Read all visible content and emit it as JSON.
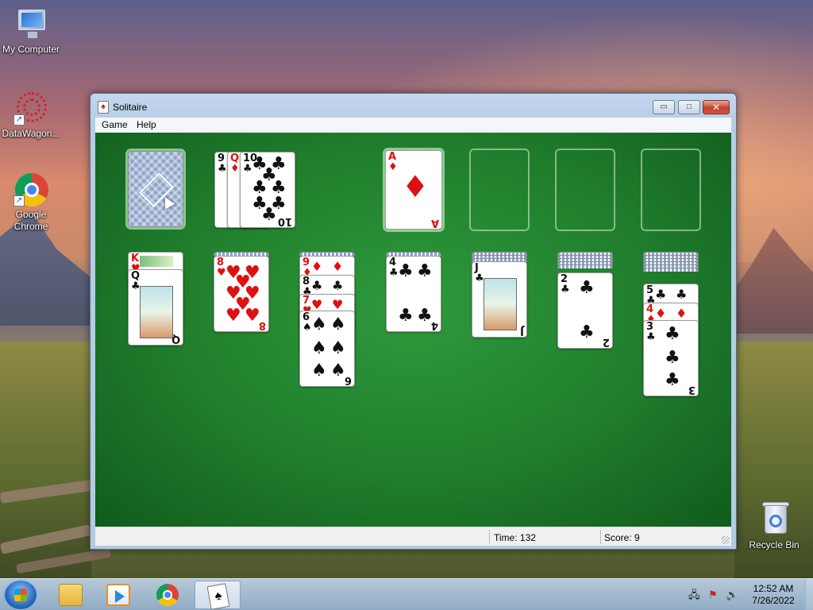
{
  "desktop": {
    "icons": [
      {
        "label": "My Computer"
      },
      {
        "label": "DataWagon..."
      },
      {
        "label": "Google\nChrome"
      },
      {
        "label": "Recycle Bin"
      }
    ]
  },
  "window": {
    "title": "Solitaire",
    "controls": {
      "minimize": "▭",
      "maximize": "□",
      "close": "✕"
    },
    "menu": [
      {
        "label": "Game"
      },
      {
        "label": "Help"
      }
    ],
    "status": {
      "time_label": "Time: 132",
      "score_label": "Score: 9"
    }
  },
  "game": {
    "waste": [
      {
        "rank": "9",
        "suit": "♣"
      },
      {
        "rank": "Q",
        "suit": "♦"
      },
      {
        "rank": "10",
        "suit": "♣"
      }
    ],
    "foundations": [
      {
        "rank": "A",
        "suit": "♦"
      },
      {
        "rank": "",
        "suit": ""
      },
      {
        "rank": "",
        "suit": ""
      },
      {
        "rank": "",
        "suit": ""
      }
    ],
    "tableau": [
      {
        "hidden": 0,
        "cards": [
          {
            "rank": "K",
            "suit": "♥"
          },
          {
            "rank": "Q",
            "suit": "♣"
          }
        ]
      },
      {
        "hidden": 1,
        "cards": [
          {
            "rank": "8",
            "suit": "♥"
          }
        ]
      },
      {
        "hidden": 1,
        "cards": [
          {
            "rank": "9",
            "suit": "♦"
          },
          {
            "rank": "8",
            "suit": "♣"
          },
          {
            "rank": "7",
            "suit": "♥"
          },
          {
            "rank": "6",
            "suit": "♠"
          }
        ]
      },
      {
        "hidden": 1,
        "cards": [
          {
            "rank": "4",
            "suit": "♣"
          }
        ]
      },
      {
        "hidden": 3,
        "cards": [
          {
            "rank": "J",
            "suit": "♣"
          }
        ]
      },
      {
        "hidden": 5,
        "cards": [
          {
            "rank": "2",
            "suit": "♣"
          }
        ]
      },
      {
        "hidden": 6,
        "cards": [
          {
            "rank": "5",
            "suit": "♣"
          },
          {
            "rank": "4",
            "suit": "♦"
          },
          {
            "rank": "3",
            "suit": "♣"
          }
        ]
      }
    ]
  },
  "taskbar": {
    "clock_time": "12:52 AM",
    "clock_date": "7/26/2022",
    "tray": {
      "network": "🖧",
      "flag": "⚑",
      "volume": "🔊"
    }
  }
}
